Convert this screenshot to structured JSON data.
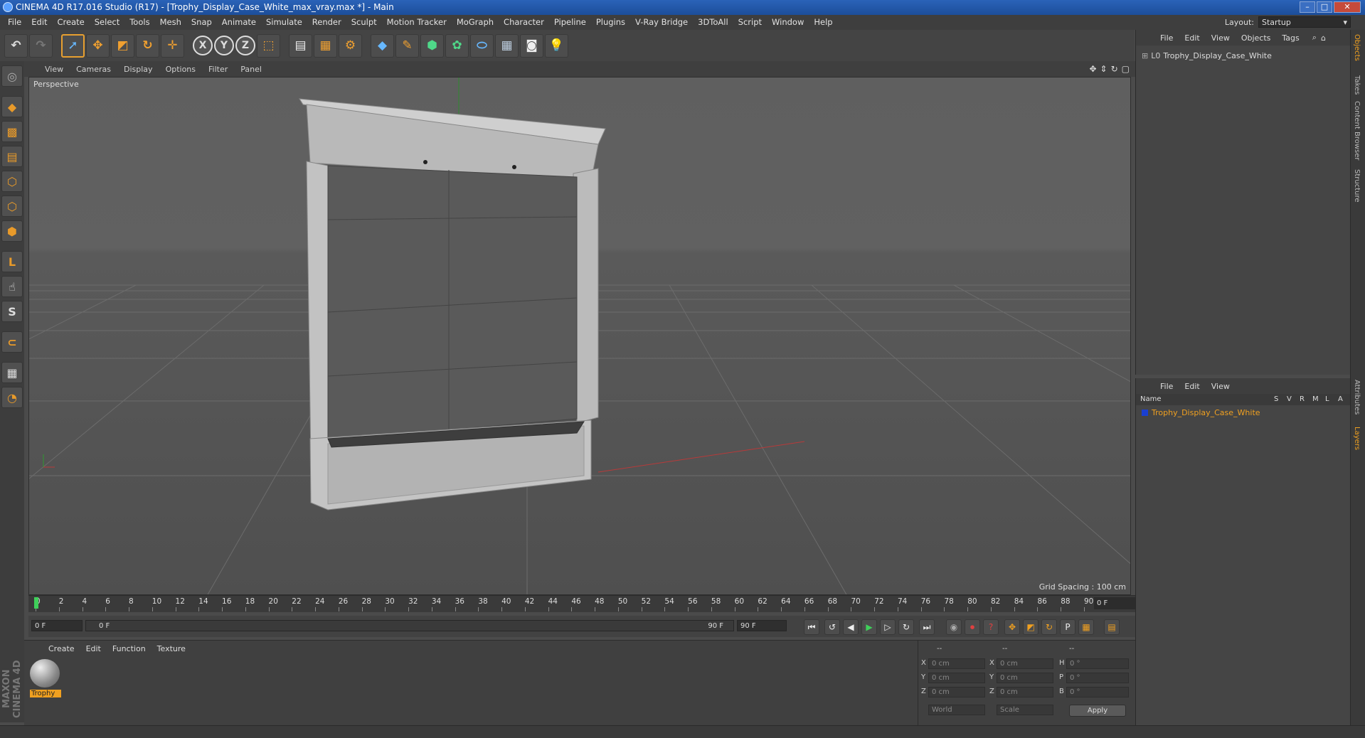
{
  "window": {
    "title": "CINEMA 4D R17.016 Studio (R17) - [Trophy_Display_Case_White_max_vray.max *] - Main",
    "buttons": {
      "minimize": "–",
      "maximize": "□",
      "close": "✕"
    }
  },
  "menubar": {
    "items": [
      "File",
      "Edit",
      "Create",
      "Select",
      "Tools",
      "Mesh",
      "Snap",
      "Animate",
      "Simulate",
      "Render",
      "Sculpt",
      "Motion Tracker",
      "MoGraph",
      "Character",
      "Pipeline",
      "Plugins",
      "V-Ray Bridge",
      "3DToAll",
      "Script",
      "Window",
      "Help"
    ],
    "layout_label": "Layout:",
    "layout_value": "Startup"
  },
  "toolbar": {
    "icons": [
      "undo-icon",
      "redo-icon",
      "select-arrow-icon",
      "move-icon",
      "scale-icon",
      "rotate-icon",
      "live-select-icon",
      "x-axis-icon",
      "y-axis-icon",
      "z-axis-icon",
      "world-coord-icon",
      "render-view-icon",
      "render-picture-viewer-icon",
      "edit-render-settings-icon",
      "cube-primitive-icon",
      "pen-spline-icon",
      "subdivision-surface-icon",
      "array-icon",
      "deformer-icon",
      "floor-icon",
      "camera-icon",
      "light-icon"
    ],
    "x_label": "X",
    "y_label": "Y",
    "z_label": "Z"
  },
  "viewport": {
    "menu": [
      "View",
      "Cameras",
      "Display",
      "Options",
      "Filter",
      "Panel"
    ],
    "label": "Perspective",
    "grid_spacing": "Grid Spacing : 100 cm"
  },
  "timeline": {
    "ticks": [
      "0",
      "2",
      "4",
      "6",
      "8",
      "10",
      "12",
      "14",
      "16",
      "18",
      "20",
      "22",
      "24",
      "26",
      "28",
      "30",
      "32",
      "34",
      "36",
      "38",
      "40",
      "42",
      "44",
      "46",
      "48",
      "50",
      "52",
      "54",
      "56",
      "58",
      "60",
      "62",
      "64",
      "66",
      "68",
      "70",
      "72",
      "74",
      "76",
      "78",
      "80",
      "82",
      "84",
      "86",
      "88",
      "90"
    ],
    "current_frame": "0 F"
  },
  "transport": {
    "start_field": "0 F",
    "range_start": "0 F",
    "range_end": "90 F",
    "end_field": "90 F"
  },
  "materials": {
    "menu": [
      "Create",
      "Edit",
      "Function",
      "Texture"
    ],
    "items": [
      {
        "name": "Trophy"
      }
    ]
  },
  "coords": {
    "header": [
      "--",
      "--",
      "--"
    ],
    "rows": [
      {
        "a": "X",
        "av": "0 cm",
        "b": "X",
        "bv": "0 cm",
        "c": "H",
        "cv": "0 °"
      },
      {
        "a": "Y",
        "av": "0 cm",
        "b": "Y",
        "bv": "0 cm",
        "c": "P",
        "cv": "0 °"
      },
      {
        "a": "Z",
        "av": "0 cm",
        "b": "Z",
        "bv": "0 cm",
        "c": "B",
        "cv": "0 °"
      }
    ],
    "mode1": "World",
    "mode2": "Scale",
    "apply": "Apply"
  },
  "objects_panel": {
    "menu": [
      "File",
      "Edit",
      "View",
      "Objects",
      "Tags"
    ],
    "object_name": "Trophy_Display_Case_White"
  },
  "layers_panel": {
    "menu": [
      "File",
      "Edit",
      "View"
    ],
    "col_name": "Name",
    "col_flags": [
      "S",
      "V",
      "R",
      "M",
      "L",
      "A"
    ],
    "layer_name": "Trophy_Display_Case_White",
    "layer_color": "#1a3fd0"
  },
  "side_tabs": [
    "Objects",
    "Takes",
    "Content Browser",
    "Structure",
    "Attributes",
    "Layers"
  ],
  "brand": "MAXON CINEMA 4D",
  "colors": {
    "accent": "#f0a020",
    "title_blue": "#2a63b8"
  }
}
